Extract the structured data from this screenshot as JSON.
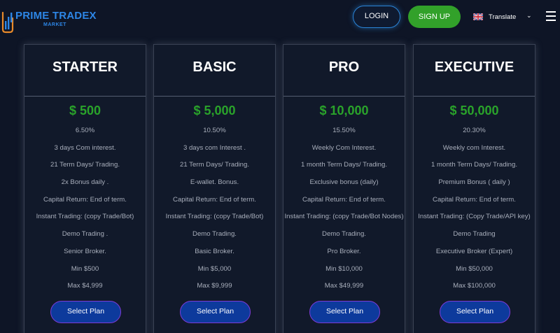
{
  "brand": {
    "name": "PRIME TRADEX",
    "subname": "MARKET"
  },
  "nav": {
    "login_label": "LOGIN",
    "signup_label": "SIGN UP",
    "translate_label": "Translate",
    "flag_icon": "uk-flag-icon",
    "chevron_icon": "chevron-down-icon",
    "menu_icon": "hamburger-menu-icon"
  },
  "colors": {
    "background": "#0e1526",
    "card_background": "#11192a",
    "price_green": "#2aa32a",
    "signup_green": "#32a12a",
    "login_border": "#2a83d6",
    "select_button_bg": "#0d3a9c",
    "select_button_border": "#7d3bd6",
    "brand_blue": "#2d86e6"
  },
  "plans": [
    {
      "title": "STARTER",
      "price": "$ 500",
      "features": [
        "6.50%",
        "3 days Com interest.",
        "21 Term Days/ Trading.",
        "2x Bonus daily .",
        "Capital Return: End of term.",
        "Instant Trading: (copy Trade/Bot)",
        "Demo Trading .",
        "Senior Broker.",
        "Min $500",
        "Max $4,999"
      ],
      "button_label": "Select Plan"
    },
    {
      "title": "BASIC",
      "price": "$ 5,000",
      "features": [
        "10.50%",
        "3 days com Interest .",
        "21 Term Days/ Trading.",
        "E-wallet. Bonus.",
        "Capital Return: End of term.",
        "Instant Trading: (copy Trade/Bot)",
        "Demo Trading.",
        "Basic Broker.",
        "Min $5,000",
        "Max $9,999"
      ],
      "button_label": "Select Plan"
    },
    {
      "title": "PRO",
      "price": "$ 10,000",
      "features": [
        "15.50%",
        "Weekly Com Interest.",
        "1 month Term Days/ Trading.",
        "Exclusive bonus (daily)",
        "Capital Return: End of term.",
        "Instant Trading: (copy Trade/Bot Nodes)",
        "Demo Trading.",
        "Pro Broker.",
        "Min $10,000",
        "Max $49,999"
      ],
      "button_label": "Select Plan"
    },
    {
      "title": "EXECUTIVE",
      "price": "$ 50,000",
      "features": [
        "20.30%",
        "Weekly com Interest.",
        "1 month Term Days/ Trading.",
        "Premium Bonus ( daily )",
        "Capital Return: End of term.",
        "Instant Trading: (Copy Trade/API key)",
        "Demo Trading",
        "Executive Broker (Expert)",
        "Min $50,000",
        "Max $100,000"
      ],
      "button_label": "Select Plan"
    }
  ]
}
